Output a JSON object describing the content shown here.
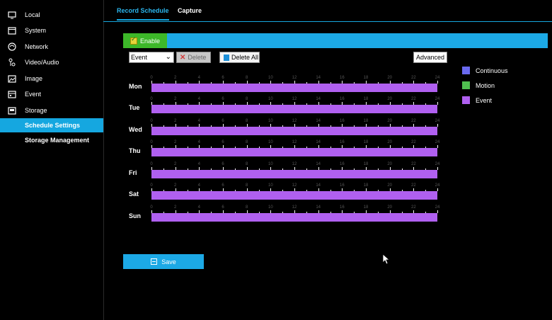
{
  "sidebar": {
    "items": [
      {
        "label": "Local",
        "icon": "monitor-icon"
      },
      {
        "label": "System",
        "icon": "window-icon"
      },
      {
        "label": "Network",
        "icon": "globe-icon"
      },
      {
        "label": "Video/Audio",
        "icon": "audio-icon"
      },
      {
        "label": "Image",
        "icon": "image-icon"
      },
      {
        "label": "Event",
        "icon": "calendar-icon"
      },
      {
        "label": "Storage",
        "icon": "storage-icon"
      }
    ],
    "sub_items": [
      {
        "label": "Schedule Settings",
        "active": true
      },
      {
        "label": "Storage Management",
        "active": false
      }
    ]
  },
  "tabs": [
    {
      "label": "Record Schedule",
      "active": true
    },
    {
      "label": "Capture",
      "active": false
    }
  ],
  "enable": {
    "label": "Enable",
    "checked": true
  },
  "toolbar": {
    "select_value": "Event",
    "delete_label": "Delete",
    "delete_all_label": "Delete All",
    "advanced_label": "Advanced"
  },
  "schedule": {
    "hours": [
      "0",
      "2",
      "4",
      "6",
      "8",
      "10",
      "12",
      "14",
      "16",
      "18",
      "20",
      "22",
      "24"
    ],
    "days": [
      {
        "label": "Mon",
        "type": "Event"
      },
      {
        "label": "Tue",
        "type": "Event"
      },
      {
        "label": "Wed",
        "type": "Event"
      },
      {
        "label": "Thu",
        "type": "Event"
      },
      {
        "label": "Fri",
        "type": "Event"
      },
      {
        "label": "Sat",
        "type": "Event"
      },
      {
        "label": "Sun",
        "type": "Event"
      }
    ]
  },
  "legend": [
    {
      "label": "Continuous",
      "color": "#6a6af0"
    },
    {
      "label": "Motion",
      "color": "#4fbf4f"
    },
    {
      "label": "Event",
      "color": "#b060f0"
    }
  ],
  "save_label": "Save",
  "colors": {
    "accent": "#15a7e0",
    "enable_green": "#3db829",
    "event": "#b060f0"
  }
}
